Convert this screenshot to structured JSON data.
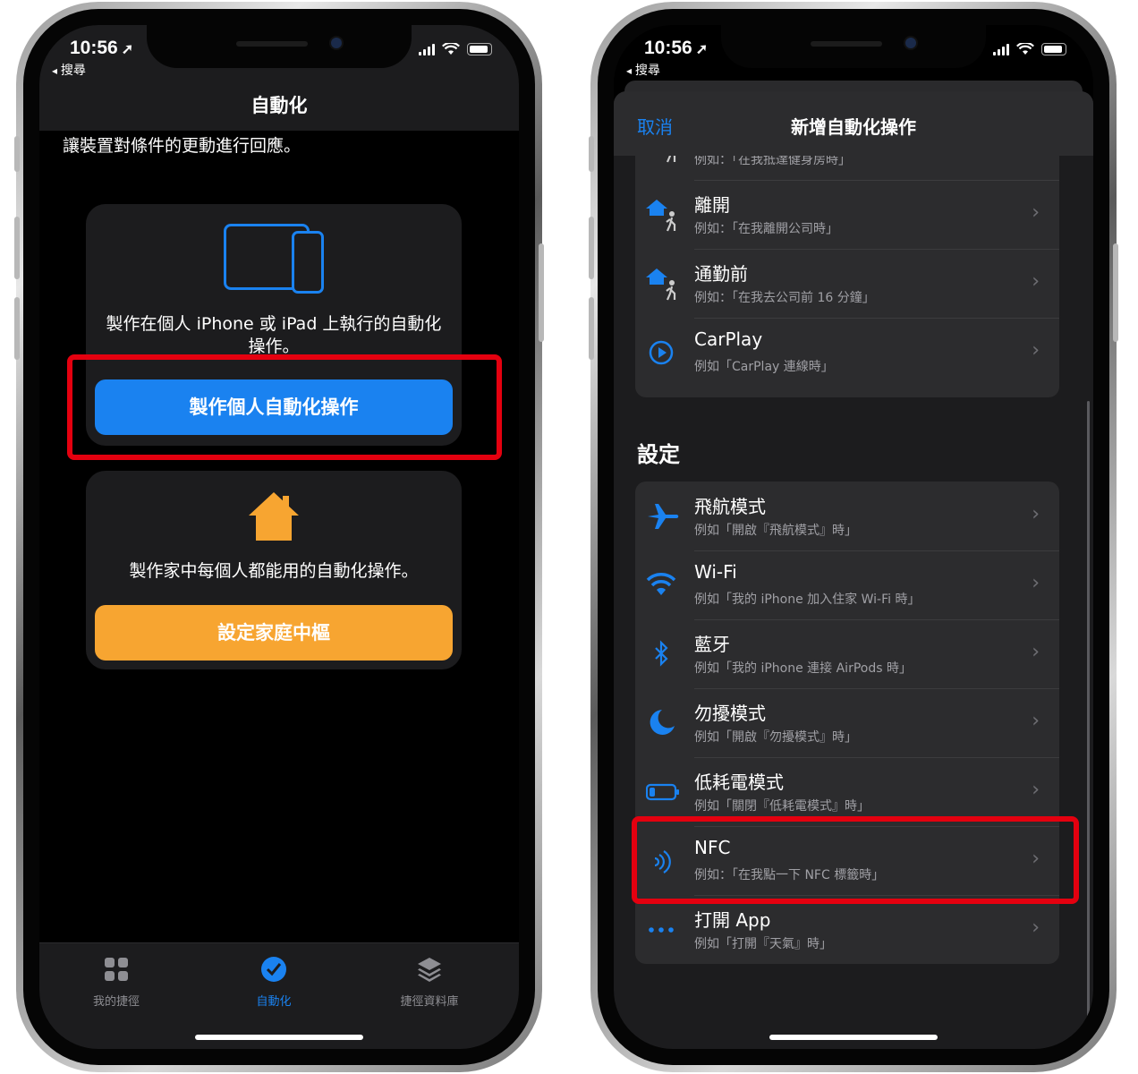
{
  "left": {
    "status": {
      "time": "10:56",
      "back": "搜尋"
    },
    "title": "自動化",
    "description": "讓裝置對條件的更動進行回應。",
    "personal_card": {
      "text": "製作在個人 iPhone 或 iPad 上執行的自動化操作。",
      "button": "製作個人自動化操作"
    },
    "home_card": {
      "text": "製作家中每個人都能用的自動化操作。",
      "button": "設定家庭中樞"
    },
    "tabs": [
      {
        "label": "我的捷徑"
      },
      {
        "label": "自動化"
      },
      {
        "label": "捷徑資料庫"
      }
    ]
  },
  "right": {
    "status": {
      "time": "10:56",
      "back": "搜尋"
    },
    "nav": {
      "cancel": "取消",
      "title": "新增自動化操作"
    },
    "travel_items": [
      {
        "title": "",
        "subtitle": "例如：「在我抵達健身房時」"
      },
      {
        "title": "離開",
        "subtitle": "例如：「在我離開公司時」"
      },
      {
        "title": "通勤前",
        "subtitle": "例如：「在我去公司前 16 分鐘」"
      },
      {
        "title": "CarPlay",
        "subtitle": "例如「CarPlay 連線時」"
      }
    ],
    "section_title": "設定",
    "settings_items": [
      {
        "title": "飛航模式",
        "subtitle": "例如「開啟『飛航模式』時」"
      },
      {
        "title": "Wi-Fi",
        "subtitle": "例如「我的 iPhone 加入住家 Wi-Fi 時」"
      },
      {
        "title": "藍牙",
        "subtitle": "例如「我的 iPhone 連接 AirPods 時」"
      },
      {
        "title": "勿擾模式",
        "subtitle": "例如「開啟『勿擾模式』時」"
      },
      {
        "title": "低耗電模式",
        "subtitle": "例如「關閉『低耗電模式』時」"
      },
      {
        "title": "NFC",
        "subtitle": "例如：「在我點一下 NFC 標籤時」"
      },
      {
        "title": "打開 App",
        "subtitle": "例如「打開『天氣』時」"
      }
    ]
  },
  "colors": {
    "accent": "#1a82f0",
    "orange": "#f7a531",
    "highlight": "#e4000f"
  }
}
